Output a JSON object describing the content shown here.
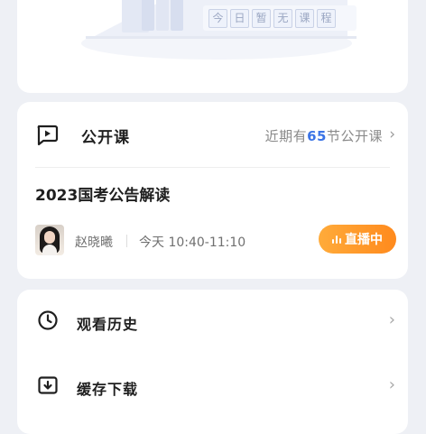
{
  "empty_state": {
    "chars": [
      "今",
      "日",
      "暂",
      "无",
      "课",
      "程"
    ]
  },
  "open_class": {
    "title": "公开课",
    "more_prefix": "近期有",
    "more_count": "65",
    "more_suffix": "节公开课",
    "course_title": "2023国考公告解读",
    "teacher": "赵晓曦",
    "time": "今天 10:40-11:10",
    "live_label": "直播中",
    "colors": {
      "accent": "#3b74e6",
      "live": "#ff9a2e"
    }
  },
  "menu": {
    "items": [
      {
        "label": "观看历史",
        "icon": "clock-icon"
      },
      {
        "label": "缓存下载",
        "icon": "download-icon"
      }
    ]
  }
}
